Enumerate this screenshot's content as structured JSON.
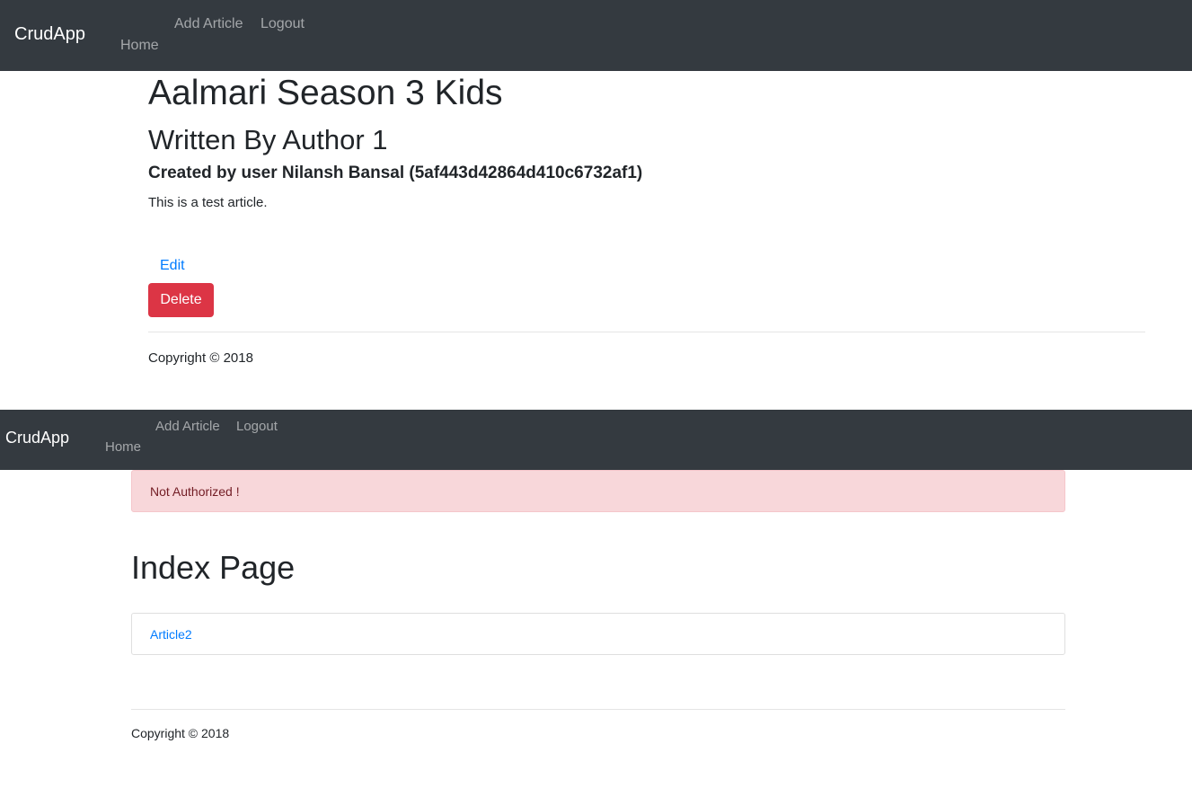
{
  "screens": [
    {
      "navbar": {
        "brand": "CrudApp",
        "links": {
          "home": "Home",
          "add_article": "Add Article",
          "logout": "Logout"
        }
      },
      "article": {
        "title": "Aalmari Season 3 Kids",
        "author_line": "Written By Author 1",
        "creator_line": "Created by user Nilansh Bansal (5af443d42864d410c6732af1)",
        "body": "This is a test article."
      },
      "actions": {
        "edit_label": "Edit",
        "delete_label": "Delete"
      },
      "footer": {
        "copyright": "Copyright © 2018"
      }
    },
    {
      "navbar": {
        "brand": "CrudApp",
        "links": {
          "home": "Home",
          "add_article": "Add Article",
          "logout": "Logout"
        }
      },
      "alert": {
        "message": "Not Authorized !"
      },
      "page_title": "Index Page",
      "articles": [
        "Article2"
      ],
      "footer": {
        "copyright": "Copyright © 2018"
      }
    }
  ],
  "colors": {
    "navbar_bg": "#343a40",
    "link": "#007bff",
    "danger": "#dc3545",
    "alert_bg": "#f8d7da",
    "alert_text": "#721c24"
  }
}
